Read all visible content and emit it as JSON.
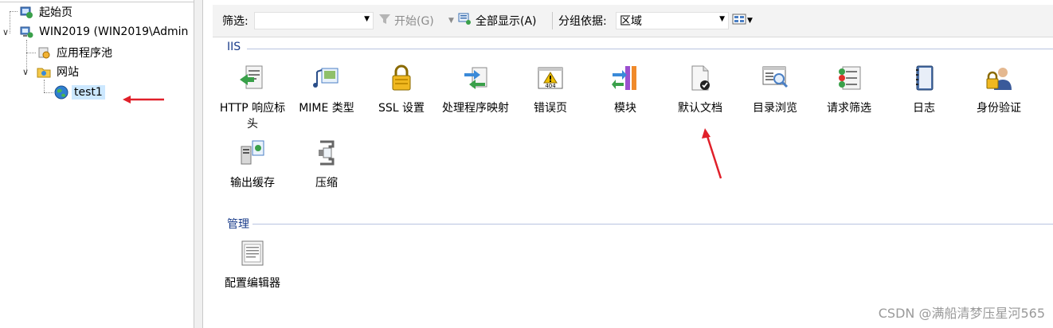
{
  "tree": {
    "start_page": "起始页",
    "server": "WIN2019 (WIN2019\\Admin",
    "app_pools": "应用程序池",
    "sites": "网站",
    "site_test1": "test1"
  },
  "toolbar": {
    "filter_label": "筛选:",
    "filter_value": "",
    "start_label": "开始(G)",
    "show_all_label": "全部显示(A)",
    "group_by_label": "分组依据:",
    "group_by_value": "区域"
  },
  "sections": {
    "iis": {
      "title": "IIS",
      "features": [
        {
          "label": "HTTP 响应标头"
        },
        {
          "label": "MIME 类型"
        },
        {
          "label": "SSL 设置"
        },
        {
          "label": "处理程序映射"
        },
        {
          "label": "错误页",
          "badge": "404"
        },
        {
          "label": "模块"
        },
        {
          "label": "默认文档"
        },
        {
          "label": "目录浏览"
        },
        {
          "label": "请求筛选"
        },
        {
          "label": "日志"
        },
        {
          "label": "身份验证"
        },
        {
          "label": "输出缓存"
        },
        {
          "label": "压缩"
        }
      ]
    },
    "manage": {
      "title": "管理",
      "features": [
        {
          "label": "配置编辑器"
        }
      ]
    }
  },
  "watermark": "CSDN @满船清梦压星河565",
  "colors": {
    "accent": "#1a3c8a",
    "arrow": "#e0202a",
    "selection": "#cce8ff"
  }
}
